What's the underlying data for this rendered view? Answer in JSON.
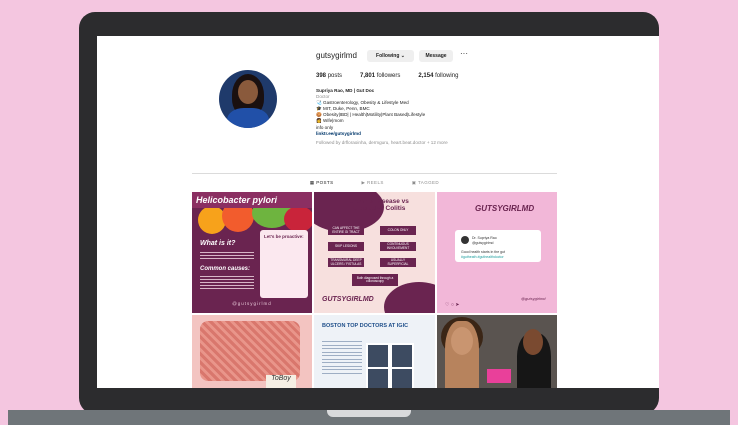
{
  "profile": {
    "username": "gutsygirlmd",
    "following_button": "Following ⌄",
    "message_button": "Message",
    "more": "···",
    "stats": {
      "posts_count": "398",
      "posts_label": "posts",
      "followers_count": "7,801",
      "followers_label": "followers",
      "following_count": "2,154",
      "following_label": "following"
    },
    "bio": {
      "name": "Supriya Rao, MD | Gut Doc",
      "category": "Doctor",
      "line1": "🩺 Gastroenterology, Obesity & Lifestyle Med",
      "line2": "🎓 MIT, Duke, Penn, BMC",
      "line3": "🍪 Obesity|IBD| | Health|Motility|Plant Based|Lifestyle",
      "line4": "👩 Wife|mom",
      "line5": "info only",
      "link": "linktr.ee/gutsygirlmd",
      "followed_by": "Followed by drfloraoinha, dermguru, heart.beat.doctor + 12 more"
    }
  },
  "tabs": {
    "posts": "▦ POSTS",
    "reels": "▶ REELS",
    "tagged": "▣ TAGGED"
  },
  "posts": {
    "p1": {
      "title": "Helicobacter pylori",
      "what": "What is it?",
      "causes": "Common causes:",
      "card": "Let's be proactive:",
      "footer": "@gutsygirlmd"
    },
    "p2": {
      "title": "Crohn's Disease vs Ulcerative Colitis",
      "boxes": [
        "CAN AFFECT THE ENTIRE GI TRACT",
        "COLON ONLY",
        "SKIP LESIONS",
        "CONTINUOUS INVOLVEMENT",
        "TRANSMURAL DEEP ULCERS / FISTULAS",
        "USUALLY SUPERFICIAL",
        "Both diagnosed through a colonoscopy"
      ],
      "hand": "GUTSYGIRLMD"
    },
    "p3": {
      "logo": "GUTSYGIRLMD",
      "card_name": "Dr. Supriya Rao",
      "card_handle": "@gutsygirlmd",
      "card_text": "Good health starts in the gut",
      "card_tags": "#gutheath #guthealthdoctor",
      "icons": "♡ ○ ➤",
      "sig": "@gutsygirlmd"
    },
    "p4": {
      "sticker": "ToBoy"
    },
    "p5": {
      "header": "BOSTON TOP DOCTORS AT IGIC"
    },
    "p6": {}
  }
}
